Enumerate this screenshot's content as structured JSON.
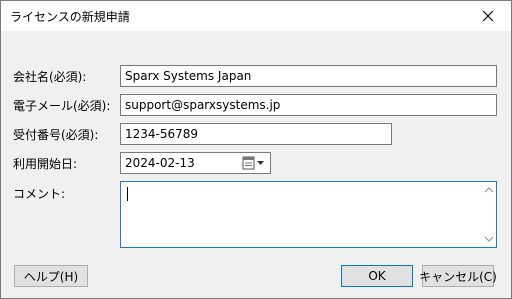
{
  "window": {
    "title": "ライセンスの新規申請"
  },
  "form": {
    "company": {
      "label": "会社名(必須):",
      "value": "Sparx Systems Japan"
    },
    "email": {
      "label": "電子メール(必須):",
      "value": "support@sparxsystems.jp"
    },
    "receipt": {
      "label": "受付番号(必須):",
      "value": "1234-56789"
    },
    "start_date": {
      "label": "利用開始日:",
      "value": "2024-02-13"
    },
    "comment": {
      "label": "コメント:",
      "value": ""
    }
  },
  "buttons": {
    "help": "ヘルプ(H)",
    "ok": "OK",
    "cancel": "キャンセル(C)"
  },
  "icons": {
    "close": "close-icon",
    "calendar": "calendar-icon",
    "dropdown": "chevron-down-icon",
    "scroll_up": "scroll-up-icon",
    "scroll_down": "scroll-down-icon"
  }
}
